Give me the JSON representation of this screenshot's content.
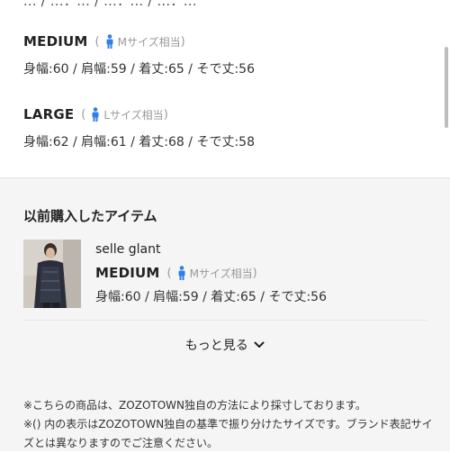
{
  "top_cutoff_text": "... / ...：... / ...：... / ...：...",
  "sizes": [
    {
      "name": "MEDIUM",
      "note": "Mサイズ相当",
      "measure": "身幅:60 / 肩幅:59 / 着丈:65 / そで丈:56"
    },
    {
      "name": "LARGE",
      "note": "Lサイズ相当",
      "measure": "身幅:62 / 肩幅:61 / 着丈:68 / そで丈:58"
    }
  ],
  "previous": {
    "title": "以前購入したアイテム",
    "item": {
      "brand": "selle glant",
      "size_name": "MEDIUM",
      "size_note": "Mサイズ相当",
      "measure": "身幅:60 / 肩幅:59 / 着丈:65 / そで丈:56"
    },
    "more_label": "もっと見る"
  },
  "notes": [
    "※こちらの商品は、ZOZOTOWN独自の方法により採寸しております。",
    "※() 内の表示はZOZOTOWN独自の基準で振り分けたサイズです。ブランド表記サイズとは異なりますのでご注意ください。"
  ],
  "colors": {
    "accent_icon": "#2f7fe6",
    "muted_text": "#999999",
    "section_bg": "#f5f5f5"
  },
  "icons": {
    "person": "person-icon",
    "chevron": "chevron-down-icon"
  }
}
